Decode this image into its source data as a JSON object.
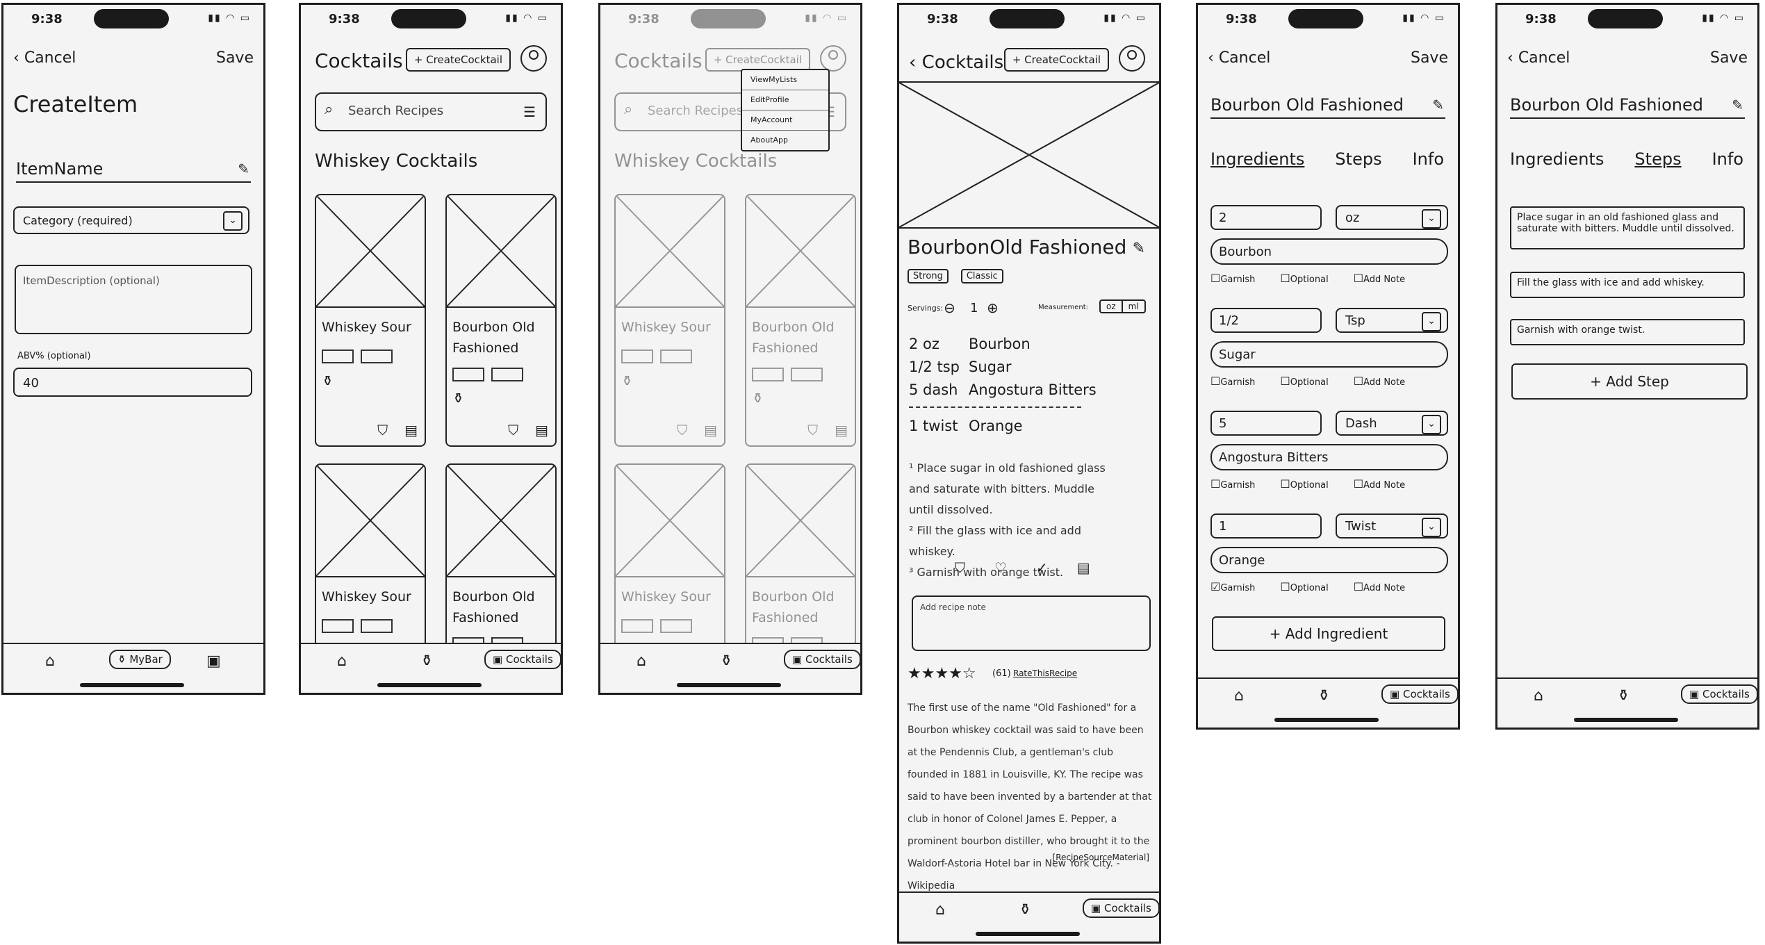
{
  "status": {
    "time": "9:38",
    "icons": "▮▮ ◠ ▭"
  },
  "icons": {
    "back": "‹",
    "pencil": "✎",
    "edit": "✎",
    "search": "⌕",
    "filter": "☰",
    "chevron": "⌄",
    "home": "⌂",
    "bottle": "⚱",
    "book": "▣",
    "bookmark": "⛉",
    "heart": "♡",
    "check": "✓",
    "note": "▤",
    "minus": "⊖",
    "plus": "⊕"
  },
  "tabbar": {
    "mybar": "MyBar",
    "cocktails": "Cocktails"
  },
  "s1": {
    "cancel": "Cancel",
    "save": "Save",
    "title": "CreateItem",
    "item_name": "ItemName",
    "category": "Category (required)",
    "description": "ItemDescription (optional)",
    "abv_label": "ABV% (optional)",
    "abv_value": "40"
  },
  "s2": {
    "title": "Cocktails",
    "create": "+ CreateCocktail",
    "search": "Search Recipes",
    "section": "Whiskey Cocktails",
    "cards": [
      {
        "name": "Whiskey Sour"
      },
      {
        "name": "Bourbon Old Fashioned"
      },
      {
        "name": "Whiskey Sour"
      },
      {
        "name": "Bourbon Old Fashioned"
      }
    ]
  },
  "s3": {
    "menu": [
      "ViewMyLists",
      "EditProfile",
      "MyAccount",
      "AboutApp"
    ]
  },
  "s4": {
    "back": "Cocktails",
    "create": "+ CreateCocktail",
    "title": "BourbonOld Fashioned",
    "tags": [
      "Strong",
      "Classic"
    ],
    "servings_label": "Servings:",
    "servings_value": "1",
    "measurement_label": "Measurement:",
    "unit_oz": "oz",
    "unit_ml": "ml",
    "ingredients": [
      {
        "qty": "2 oz",
        "name": "Bourbon"
      },
      {
        "qty": "1/2 tsp",
        "name": "Sugar"
      },
      {
        "qty": "5 dash",
        "name": "Angostura Bitters"
      }
    ],
    "garnish": {
      "qty": "1 twist",
      "name": "Orange"
    },
    "steps": [
      "¹ Place sugar in old fashioned glass and saturate with bitters. Muddle until dissolved.",
      "² Fill the glass with ice and add whiskey.",
      "³ Garnish with orange twist."
    ],
    "note_placeholder": "Add recipe note",
    "stars": "★★★★☆",
    "rating_count": "(61)",
    "rate_link": "RateThisRecipe",
    "description": "The first use of the name \"Old Fashioned\" for a Bourbon whiskey cocktail was said to have been at the Pendennis Club, a gentleman's club founded in 1881 in Louisville, KY. The recipe was said to have been invented by a bartender at that club in honor of Colonel James E. Pepper, a prominent bourbon distiller, who brought it to the Waldorf-Astoria Hotel bar in New York City. - Wikipedia",
    "source": "[RecipeSourceMaterial]"
  },
  "s5": {
    "cancel": "Cancel",
    "save": "Save",
    "title": "Bourbon Old Fashioned",
    "tabs": [
      "Ingredients",
      "Steps",
      "Info"
    ],
    "check_labels": [
      "Garnish",
      "Optional",
      "Add Note"
    ],
    "rows": [
      {
        "qty": "2",
        "unit": "oz",
        "name": "Bourbon"
      },
      {
        "qty": "1/2",
        "unit": "Tsp",
        "name": "Sugar"
      },
      {
        "qty": "5",
        "unit": "Dash",
        "name": "Angostura Bitters"
      },
      {
        "qty": "1",
        "unit": "Twist",
        "name": "Orange"
      }
    ],
    "add_ingredient": "+ Add Ingredient"
  },
  "s6": {
    "steps": [
      "Place sugar in an old fashioned glass and saturate with bitters. Muddle until dissolved.",
      "Fill the glass with ice and add whiskey.",
      "Garnish with orange twist."
    ],
    "add_step": "+ Add Step"
  }
}
